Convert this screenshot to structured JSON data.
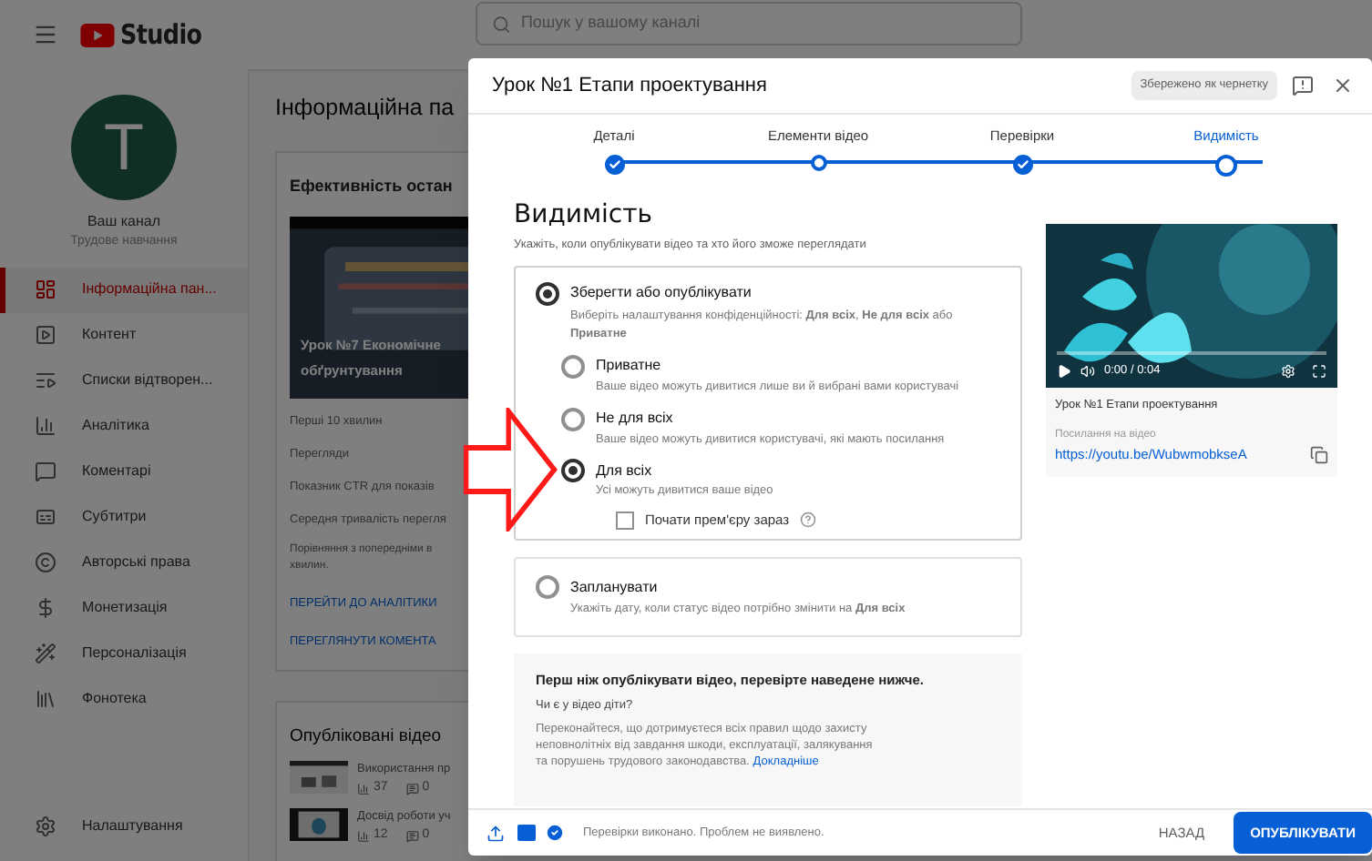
{
  "topbar": {
    "logo_text": "Studio",
    "search": {
      "placeholder": "Пошук у вашому каналі"
    }
  },
  "sidebar": {
    "channel": {
      "initial": "T",
      "name": "Ваш канал",
      "subtitle": "Трудове навчання"
    },
    "items": [
      {
        "kind": "dashboard",
        "label": "Інформаційна пан...",
        "selected": true
      },
      {
        "kind": "content",
        "label": "Контент",
        "selected": false
      },
      {
        "kind": "playlists",
        "label": "Списки відтворен...",
        "selected": false
      },
      {
        "kind": "analytics",
        "label": "Аналітика",
        "selected": false
      },
      {
        "kind": "comments",
        "label": "Коментарі",
        "selected": false
      },
      {
        "kind": "subtitles",
        "label": "Субтитри",
        "selected": false
      },
      {
        "kind": "copyright",
        "label": "Авторські права",
        "selected": false
      },
      {
        "kind": "money",
        "label": "Монетизація",
        "selected": false
      },
      {
        "kind": "customize",
        "label": "Персоналізація",
        "selected": false
      },
      {
        "kind": "library",
        "label": "Фонотека",
        "selected": false
      }
    ],
    "settings": "Налаштування"
  },
  "main": {
    "title": "Інформаційна па",
    "performance": {
      "title": "Ефективність остан",
      "video_title": "Урок №7 Економічне",
      "video_title_2": "обґрунтування",
      "metrics": [
        "Перші 10 хвилин",
        "Перегляди",
        "Показник CTR для показів",
        "Середня тривалість перегля"
      ],
      "note": [
        "Порівняння з попередніми в",
        "хвилин."
      ],
      "links": [
        "ПЕРЕЙТИ ДО АНАЛІТИКИ",
        "ПЕРЕГЛЯНУТИ КОМЕНТА"
      ]
    },
    "published": {
      "title": "Опубліковані відео",
      "videos": [
        {
          "title": "Використання пр",
          "views": "37",
          "comments": "0"
        },
        {
          "title": "Досвід роботи уч",
          "views": "12",
          "comments": "0"
        }
      ]
    }
  },
  "dialog": {
    "title": "Урок №1 Етапи проектування",
    "draft_chip": "Збережено як чернетку",
    "steps": [
      {
        "label": "Деталі",
        "done": true,
        "selected": false
      },
      {
        "label": "Елементи відео",
        "done": false,
        "selected": false
      },
      {
        "label": "Перевірки",
        "done": true,
        "selected": false
      },
      {
        "label": "Видимість",
        "done": false,
        "selected": true
      }
    ],
    "heading": "Видимість",
    "subheading": "Укажіть, коли опублікувати відео та хто його зможе переглядати",
    "save_option": {
      "label": "Зберегти або опублікувати",
      "selected": true,
      "description": "Виберіть налаштування конфіденційності: **Для всіх**, **Не для всіх** або **Приватне**",
      "choices": [
        {
          "label": "Приватне",
          "description": "Ваше відео можуть дивитися лише ви й вибрані вами користувачі",
          "selected": false
        },
        {
          "label": "Не для всіх",
          "description": "Ваше відео можуть дивитися користувачі, які мають посилання",
          "selected": false
        },
        {
          "label": "Для всіх",
          "description": "Усі можуть дивитися ваше відео",
          "selected": true
        }
      ],
      "premiere": {
        "label": "Почати прем'єру зараз",
        "checked": false
      }
    },
    "schedule_option": {
      "label": "Запланувати",
      "selected": false,
      "description": "Укажіть дату, коли статус відео потрібно змінити на **Для всіх**"
    },
    "checklist": {
      "heading": "Перш ніж опублікувати відео, перевірте наведене нижче.",
      "question": "Чи є у відео діти?",
      "text": "Переконайтеся, що дотримуєтеся всіх правил щодо захисту неповнолітніх від завдання шкоди, експлуатації, залякування та порушень трудового законодавства.",
      "link": "Докладніше"
    },
    "preview": {
      "time": "0:00 / 0:04",
      "title": "Урок №1 Етапи проектування",
      "link_label": "Посилання на відео",
      "link": "https://youtu.be/WubwmobkseA"
    },
    "footer": {
      "status": "Перевірки виконано. Проблем не виявлено.",
      "back": "НАЗАД",
      "publish": "ОПУБЛІКУВАТИ"
    }
  }
}
